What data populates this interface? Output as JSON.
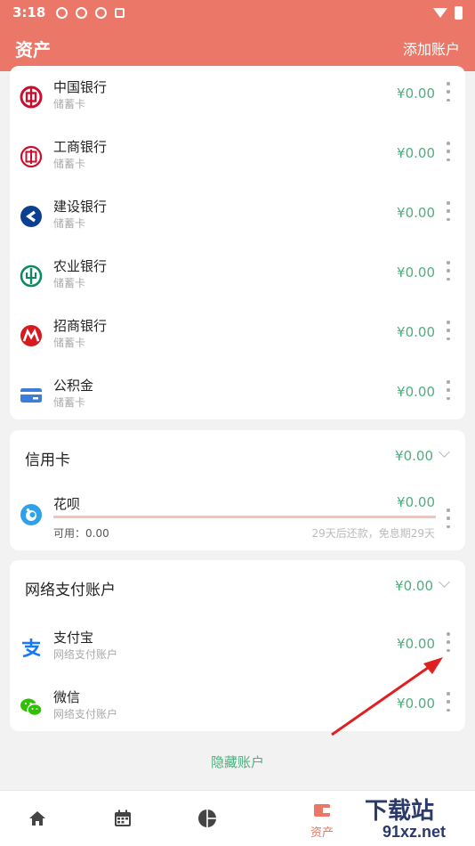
{
  "status_bar": {
    "time": "3:18"
  },
  "appbar": {
    "title": "资产",
    "add_account": "添加账户"
  },
  "debit_accounts": [
    {
      "name": "中国银行",
      "type": "储蓄卡",
      "amount": "¥0.00",
      "icon": "boc-icon",
      "color": "#c8102e"
    },
    {
      "name": "工商银行",
      "type": "储蓄卡",
      "amount": "¥0.00",
      "icon": "icbc-icon",
      "color": "#c8102e"
    },
    {
      "name": "建设银行",
      "type": "储蓄卡",
      "amount": "¥0.00",
      "icon": "ccb-icon",
      "color": "#0b3f92"
    },
    {
      "name": "农业银行",
      "type": "储蓄卡",
      "amount": "¥0.00",
      "icon": "abc-icon",
      "color": "#0f8a5f"
    },
    {
      "name": "招商银行",
      "type": "储蓄卡",
      "amount": "¥0.00",
      "icon": "cmb-icon",
      "color": "#d71920"
    },
    {
      "name": "公积金",
      "type": "储蓄卡",
      "amount": "¥0.00",
      "icon": "card-icon",
      "color": "#3b7ddd"
    }
  ],
  "credit_section": {
    "title": "信用卡",
    "total": "¥0.00",
    "items": [
      {
        "name": "花呗",
        "amount": "¥0.00",
        "available_label": "可用：0.00",
        "repay_info": "29天后还款，免息期29天",
        "icon": "huabei-icon",
        "color": "#2fa1e9",
        "usage_fraction": 0
      }
    ]
  },
  "online_section": {
    "title": "网络支付账户",
    "total": "¥0.00",
    "items": [
      {
        "name": "支付宝",
        "type": "网络支付账户",
        "amount": "¥0.00",
        "icon": "alipay-icon",
        "color": "#1677ff"
      },
      {
        "name": "微信",
        "type": "网络支付账户",
        "amount": "¥0.00",
        "icon": "wechat-icon",
        "color": "#2dc100"
      }
    ]
  },
  "hide_accounts": "隐藏账户",
  "bottom_nav": {
    "assets_label": "资产"
  },
  "watermark": {
    "line1": "下载站",
    "line2": "91xz.net"
  },
  "colors": {
    "accent": "#ea7767",
    "money": "#4caf7d"
  }
}
